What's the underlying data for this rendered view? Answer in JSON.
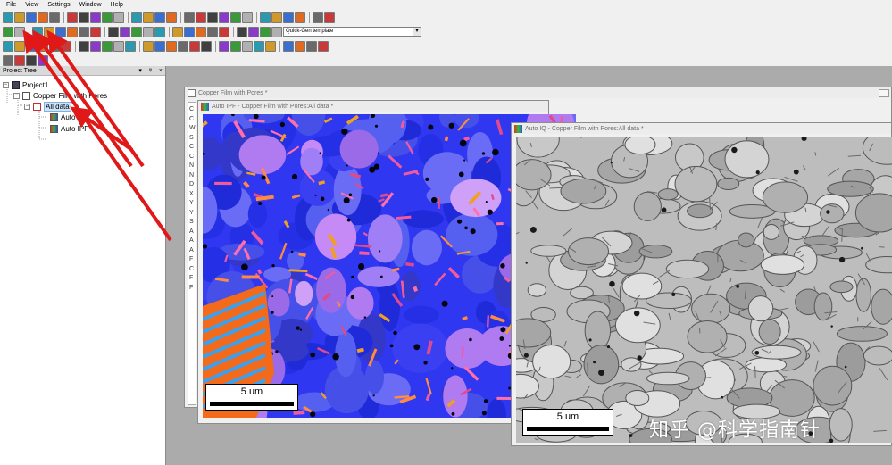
{
  "menu": [
    "File",
    "View",
    "Settings",
    "Window",
    "Help"
  ],
  "toolbar": {
    "template_combo": "Quick-Gen template"
  },
  "tree": {
    "title": "Project Tree",
    "controls": [
      "▾",
      "ᵠ",
      "×"
    ],
    "nodes": [
      {
        "label": "Project1"
      },
      {
        "label": "Copper Film with Pores"
      },
      {
        "label": "All data"
      },
      {
        "label": "Auto IQ"
      },
      {
        "label": "Auto IPF"
      }
    ]
  },
  "windows": {
    "dataset": {
      "title": "Copper Film with Pores *",
      "side_letters": [
        "C",
        "C",
        "W",
        "S",
        "C",
        "C",
        "N",
        "N",
        "D",
        "X",
        "Y",
        "Y",
        "S",
        "A",
        "A",
        "A",
        "F",
        "C",
        "F",
        "F"
      ]
    },
    "ipf": {
      "title": "Auto IPF - Copper Film with Pores:All data *",
      "scale_label": "5 um"
    },
    "iq": {
      "title": "Auto IQ - Copper Film with Pores:All data *",
      "scale_label": "5 um"
    }
  },
  "watermark": "知乎 @科学指南针",
  "colors": {
    "ipf_base": "#2f37f0",
    "arrow": "#e01818",
    "selection": "#cde4fb"
  }
}
